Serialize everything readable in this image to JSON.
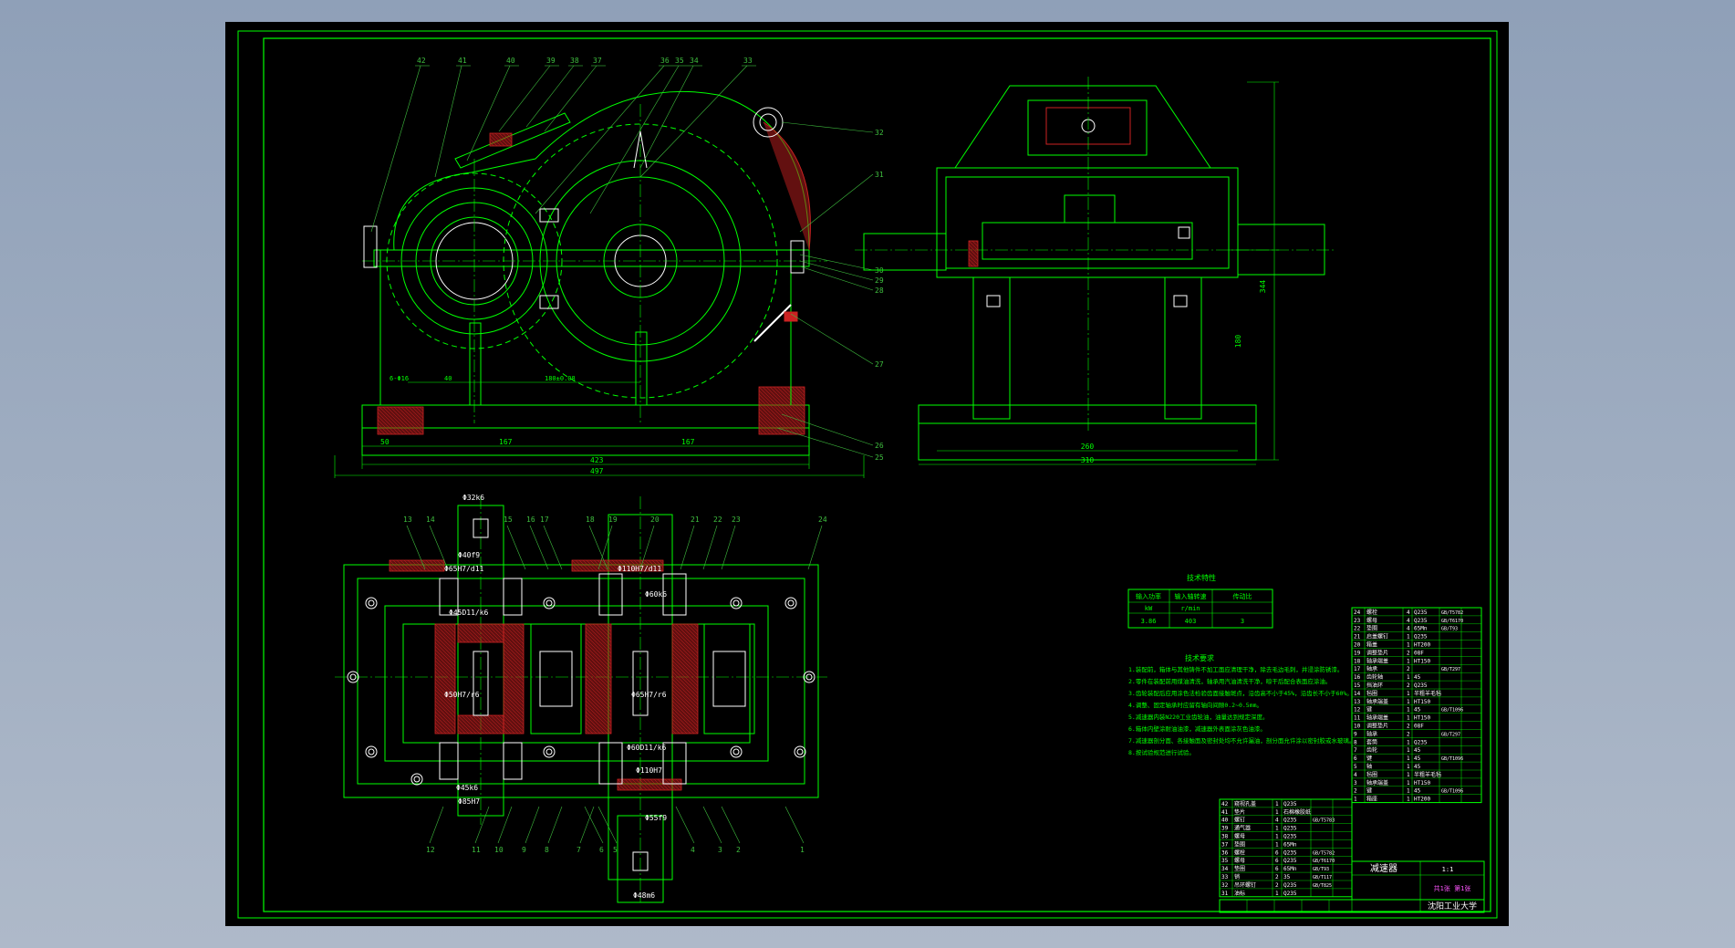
{
  "colors": {
    "background": "#9aa9bd",
    "sheet": "#000000",
    "line": "#00ff00",
    "detail": "#ffffff",
    "section": "#cc2222",
    "callout": "#3fbf3f"
  },
  "drawing": {
    "front_view": {
      "labels": [
        "42",
        "41",
        "40",
        "39",
        "38",
        "37",
        "36",
        "35",
        "34",
        "33",
        "32",
        "31",
        "30",
        "29",
        "28",
        "27",
        "26",
        "25"
      ],
      "dims": {
        "bottom_a": "50",
        "bottom_b": "167",
        "bottom_c": "167",
        "overall_a": "423",
        "overall_b": "497",
        "center": "180±0.08",
        "hole": "6-Φ16",
        "foot": "40"
      }
    },
    "side_view": {
      "dims": {
        "height": "344",
        "axis": "180",
        "base_a": "260",
        "base_b": "310"
      }
    },
    "top_view": {
      "labels_top": [
        "13",
        "14",
        "15",
        "16",
        "17",
        "18",
        "19",
        "20",
        "21",
        "22",
        "23",
        "24"
      ],
      "labels_bottom": [
        "12",
        "11",
        "10",
        "9",
        "8",
        "7",
        "6",
        "5",
        "4",
        "3",
        "2",
        "1"
      ],
      "fits": [
        "Φ32k6",
        "Φ40f9",
        "Φ65H7/d11",
        "Φ45D11/k6",
        "Φ110H7/d11",
        "Φ60k6",
        "Φ50H7/r6",
        "Φ65H7/r6",
        "Φ60D11/k6",
        "Φ110H7",
        "Φ45k6",
        "Φ85H7",
        "Φ55f9",
        "Φ48m6"
      ]
    }
  },
  "tech_table": {
    "title": "技术特性",
    "headers": [
      "输入功率",
      "输入轴转速",
      "传动比"
    ],
    "units": [
      "kW",
      "r/min",
      ""
    ],
    "values": [
      "3.86",
      "403",
      "3"
    ]
  },
  "tech_req": {
    "title": "技术要求",
    "lines": [
      "1.装配前，箱体与其他铸件不加工面应清理干净，除去毛边毛刺，并浸涂防锈漆。",
      "2.零件在装配前用煤油清洗，轴承用汽油清洗干净，晾干后配合表面应涂油。",
      "3.齿轮装配后应用涂色法检验齿面接触斑点，沿齿高不小于45%，沿齿长不小于60%。",
      "4.调整、固定轴承时应留有轴向间隙0.2~0.5mm。",
      "5.减速器内装N220工业齿轮油，油量达到规定深度。",
      "6.箱体内壁涂耐油油漆，减速器外表面涂灰色油漆。",
      "7.减速器剖分面、各接触面及密封处均不允许漏油，剖分面允许涂以密封胶或水玻璃。",
      "8.按试验规范进行试验。"
    ]
  },
  "bom_upper": [
    {
      "no": "24",
      "name": "螺栓",
      "qty": "4",
      "mat": "Q235",
      "std": "GB/T5782"
    },
    {
      "no": "23",
      "name": "螺母",
      "qty": "4",
      "mat": "Q235",
      "std": "GB/T6170"
    },
    {
      "no": "22",
      "name": "垫圈",
      "qty": "4",
      "mat": "65Mn",
      "std": "GB/T93"
    },
    {
      "no": "21",
      "name": "启盖螺钉",
      "qty": "1",
      "mat": "Q235",
      "std": ""
    },
    {
      "no": "20",
      "name": "箱盖",
      "qty": "1",
      "mat": "HT200",
      "std": ""
    },
    {
      "no": "19",
      "name": "调整垫片",
      "qty": "2",
      "mat": "08F",
      "std": ""
    },
    {
      "no": "18",
      "name": "轴承端盖",
      "qty": "1",
      "mat": "HT150",
      "std": ""
    },
    {
      "no": "17",
      "name": "轴承",
      "qty": "2",
      "mat": "",
      "std": "GB/T297"
    },
    {
      "no": "16",
      "name": "齿轮轴",
      "qty": "1",
      "mat": "45",
      "std": ""
    },
    {
      "no": "15",
      "name": "挡油环",
      "qty": "2",
      "mat": "Q235",
      "std": ""
    },
    {
      "no": "14",
      "name": "毡圈",
      "qty": "1",
      "mat": "半粗羊毛毡",
      "std": ""
    },
    {
      "no": "13",
      "name": "轴承端盖",
      "qty": "1",
      "mat": "HT150",
      "std": ""
    },
    {
      "no": "12",
      "name": "键",
      "qty": "1",
      "mat": "45",
      "std": "GB/T1096"
    },
    {
      "no": "11",
      "name": "轴承端盖",
      "qty": "1",
      "mat": "HT150",
      "std": ""
    },
    {
      "no": "10",
      "name": "调整垫片",
      "qty": "2",
      "mat": "08F",
      "std": ""
    },
    {
      "no": "9",
      "name": "轴承",
      "qty": "2",
      "mat": "",
      "std": "GB/T297"
    },
    {
      "no": "8",
      "name": "套筒",
      "qty": "1",
      "mat": "Q235",
      "std": ""
    },
    {
      "no": "7",
      "name": "齿轮",
      "qty": "1",
      "mat": "45",
      "std": ""
    },
    {
      "no": "6",
      "name": "键",
      "qty": "1",
      "mat": "45",
      "std": "GB/T1096"
    },
    {
      "no": "5",
      "name": "轴",
      "qty": "1",
      "mat": "45",
      "std": ""
    },
    {
      "no": "4",
      "name": "毡圈",
      "qty": "1",
      "mat": "半粗羊毛毡",
      "std": ""
    },
    {
      "no": "3",
      "name": "轴承端盖",
      "qty": "1",
      "mat": "HT150",
      "std": ""
    },
    {
      "no": "2",
      "name": "键",
      "qty": "1",
      "mat": "45",
      "std": "GB/T1096"
    },
    {
      "no": "1",
      "name": "箱座",
      "qty": "1",
      "mat": "HT200",
      "std": ""
    }
  ],
  "bom_lower": [
    {
      "no": "42",
      "name": "窥视孔盖",
      "qty": "1",
      "mat": "Q235",
      "std": ""
    },
    {
      "no": "41",
      "name": "垫片",
      "qty": "1",
      "mat": "石棉橡胶纸",
      "std": ""
    },
    {
      "no": "40",
      "name": "螺钉",
      "qty": "4",
      "mat": "Q235",
      "std": "GB/T5783"
    },
    {
      "no": "39",
      "name": "通气器",
      "qty": "1",
      "mat": "Q235",
      "std": ""
    },
    {
      "no": "38",
      "name": "螺母",
      "qty": "1",
      "mat": "Q235",
      "std": ""
    },
    {
      "no": "37",
      "name": "垫圈",
      "qty": "1",
      "mat": "65Mn",
      "std": ""
    },
    {
      "no": "36",
      "name": "螺栓",
      "qty": "6",
      "mat": "Q235",
      "std": "GB/T5782"
    },
    {
      "no": "35",
      "name": "螺母",
      "qty": "6",
      "mat": "Q235",
      "std": "GB/T6170"
    },
    {
      "no": "34",
      "name": "垫圈",
      "qty": "6",
      "mat": "65Mn",
      "std": "GB/T93"
    },
    {
      "no": "33",
      "name": "销",
      "qty": "2",
      "mat": "35",
      "std": "GB/T117"
    },
    {
      "no": "32",
      "name": "吊环螺钉",
      "qty": "2",
      "mat": "Q235",
      "std": "GB/T825"
    },
    {
      "no": "31",
      "name": "油标",
      "qty": "1",
      "mat": "Q235",
      "std": ""
    }
  ],
  "title_block": {
    "name": "减速器",
    "school": "沈阳工业大学",
    "scale": "1:1",
    "sheet": "共1张 第1张"
  }
}
